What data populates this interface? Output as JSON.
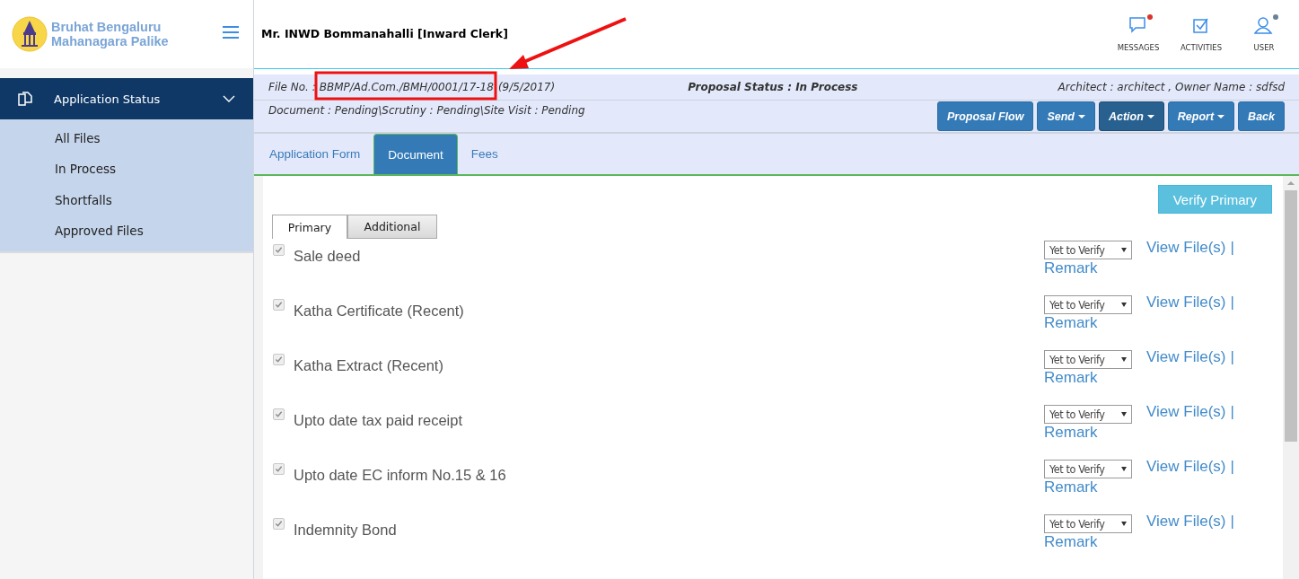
{
  "brand": {
    "lines": [
      "Bruhat Bengaluru",
      "Mahanagara Palike"
    ]
  },
  "sidebar": {
    "section": {
      "label": "Application Status",
      "expanded": true
    },
    "items": [
      {
        "label": "All Files"
      },
      {
        "label": "In Process"
      },
      {
        "label": "Shortfalls"
      },
      {
        "label": "Approved Files"
      }
    ]
  },
  "header": {
    "user": "Mr. INWD Bommanahalli [Inward Clerk]",
    "actions": [
      {
        "label": "MESSAGES",
        "kind": "messages",
        "color": "#d9342b"
      },
      {
        "label": "ACTIVITIES",
        "kind": "activities"
      },
      {
        "label": "USER",
        "kind": "user",
        "color": "#6b8296"
      }
    ]
  },
  "info": {
    "file_no_label": "File No. :",
    "file_no": "BBMP/Ad.Com./BMH/0001/17-18",
    "file_date": "(9/5/2017)",
    "proposal_status": "Proposal Status : In Process",
    "parties": "Architect : architect , Owner Name : sdfsd",
    "progress": "Document : Pending\\Scrutiny : Pending\\Site Visit : Pending"
  },
  "buttons": [
    {
      "label": "Proposal Flow",
      "dropdown": false,
      "selected": false
    },
    {
      "label": "Send",
      "dropdown": true,
      "selected": false
    },
    {
      "label": "Action",
      "dropdown": true,
      "selected": true
    },
    {
      "label": "Report",
      "dropdown": true,
      "selected": false
    },
    {
      "label": "Back",
      "dropdown": false,
      "selected": false
    }
  ],
  "tabs": [
    {
      "label": "Application Form",
      "selected": false
    },
    {
      "label": "Document",
      "selected": true
    },
    {
      "label": "Fees",
      "selected": false
    }
  ],
  "verify_button": "Verify Primary",
  "subtabs": [
    {
      "label": "Primary",
      "selected": true
    },
    {
      "label": "Additional",
      "selected": false
    }
  ],
  "documents": [
    {
      "name": "Sale deed",
      "checked": true,
      "status": "Yet to Verify",
      "view_link": "View File(s)",
      "separator": "|",
      "remark": "Remark"
    },
    {
      "name": "Katha Certificate (Recent)",
      "checked": true,
      "status": "Yet to Verify",
      "view_link": "View File(s)",
      "separator": "|",
      "remark": "Remark"
    },
    {
      "name": "Katha Extract (Recent)",
      "checked": true,
      "status": "Yet to Verify",
      "view_link": "View File(s)",
      "separator": "|",
      "remark": "Remark"
    },
    {
      "name": "Upto date tax paid receipt",
      "checked": true,
      "status": "Yet to Verify",
      "view_link": "View File(s)",
      "separator": "|",
      "remark": "Remark"
    },
    {
      "name": "Upto date EC inform No.15 & 16",
      "checked": true,
      "status": "Yet to Verify",
      "view_link": "View File(s)",
      "separator": "|",
      "remark": "Remark"
    },
    {
      "name": "Indemnity Bond",
      "checked": true,
      "status": "Yet to Verify",
      "view_link": "View File(s)",
      "separator": "|",
      "remark": "Remark"
    }
  ]
}
